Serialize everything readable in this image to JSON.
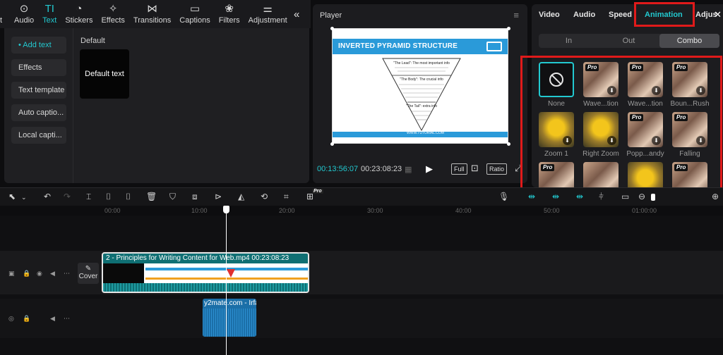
{
  "top_toolbar": {
    "cut_label": "t",
    "tools": [
      {
        "label": "Audio",
        "icon": "⊙",
        "name": "audio"
      },
      {
        "label": "Text",
        "icon": "TI",
        "name": "text"
      },
      {
        "label": "Stickers",
        "icon": "◔",
        "name": "stickers"
      },
      {
        "label": "Effects",
        "icon": "✧",
        "name": "effects"
      },
      {
        "label": "Transitions",
        "icon": "⋈",
        "name": "transitions"
      },
      {
        "label": "Captions",
        "icon": "▭",
        "name": "captions"
      },
      {
        "label": "Filters",
        "icon": "❀",
        "name": "filters"
      },
      {
        "label": "Adjustment",
        "icon": "⚌",
        "name": "adjustment"
      }
    ],
    "collapse_icon": "«"
  },
  "left_panel": {
    "nav": [
      "• Add text",
      "Effects",
      "Text template",
      "Auto captio...",
      "Local capti..."
    ],
    "section_label": "Default",
    "card_label": "Default text"
  },
  "player": {
    "title": "Player",
    "menu_icon": "≡",
    "current_time": "00:13:56:07",
    "total_time": "00:23:08:23",
    "grid_icon": "▦",
    "play_icon": "▶",
    "full_label": "Full",
    "fit_icon": "⊡",
    "ratio_label": "Ratio",
    "expand_icon": "⤢",
    "slide": {
      "heading": "INVERTED PYRAMID STRUCTURE",
      "lead": "\"The Lead\": The most important info",
      "body": "\"The Body\": The crucial info",
      "tail": "\"The Tail\": extra info",
      "footer": "WWW.TUTORIAL.COM"
    }
  },
  "inspector": {
    "tabs": [
      "Video",
      "Audio",
      "Speed",
      "Animation",
      "Adjus"
    ],
    "close_icon": "✕",
    "subtabs": [
      "In",
      "Out",
      "Combo"
    ],
    "pro_label": "Pro",
    "download_icon": "⬇",
    "items": [
      {
        "label": "None",
        "pro": false,
        "kind": "none"
      },
      {
        "label": "Wave...tion",
        "pro": true,
        "kind": "blur"
      },
      {
        "label": "Wave...tion",
        "pro": true,
        "kind": "blur"
      },
      {
        "label": "Boun...Rush",
        "pro": true,
        "kind": "blur"
      },
      {
        "label": "Zoom 1",
        "pro": false,
        "kind": "flower"
      },
      {
        "label": "Right Zoom",
        "pro": false,
        "kind": "flower"
      },
      {
        "label": "Popp...andy",
        "pro": true,
        "kind": "blur"
      },
      {
        "label": "Falling",
        "pro": true,
        "kind": "blur"
      },
      {
        "label": "",
        "pro": true,
        "kind": "blur"
      },
      {
        "label": "",
        "pro": false,
        "kind": "blur"
      },
      {
        "label": "",
        "pro": false,
        "kind": "flower"
      },
      {
        "label": "",
        "pro": true,
        "kind": "blur"
      }
    ]
  },
  "timeline": {
    "pro_badge": "Pro",
    "ruler": [
      "00:00",
      "10:00",
      "20:00",
      "30:00",
      "40:00",
      "50:00",
      "01:00:00"
    ],
    "cover_label": "Cover",
    "cover_icon": "✎",
    "video_clip_title": "2 -  Principles for Writing Content for Web.mp4   00:23:08:23",
    "audio_clip_title": "y2mate.com - Irfa"
  },
  "colors": {
    "accent": "#22c9d0",
    "highlight": "#e01a1a",
    "panel": "#1f1f22",
    "slide_blue": "#2a9ad9"
  }
}
